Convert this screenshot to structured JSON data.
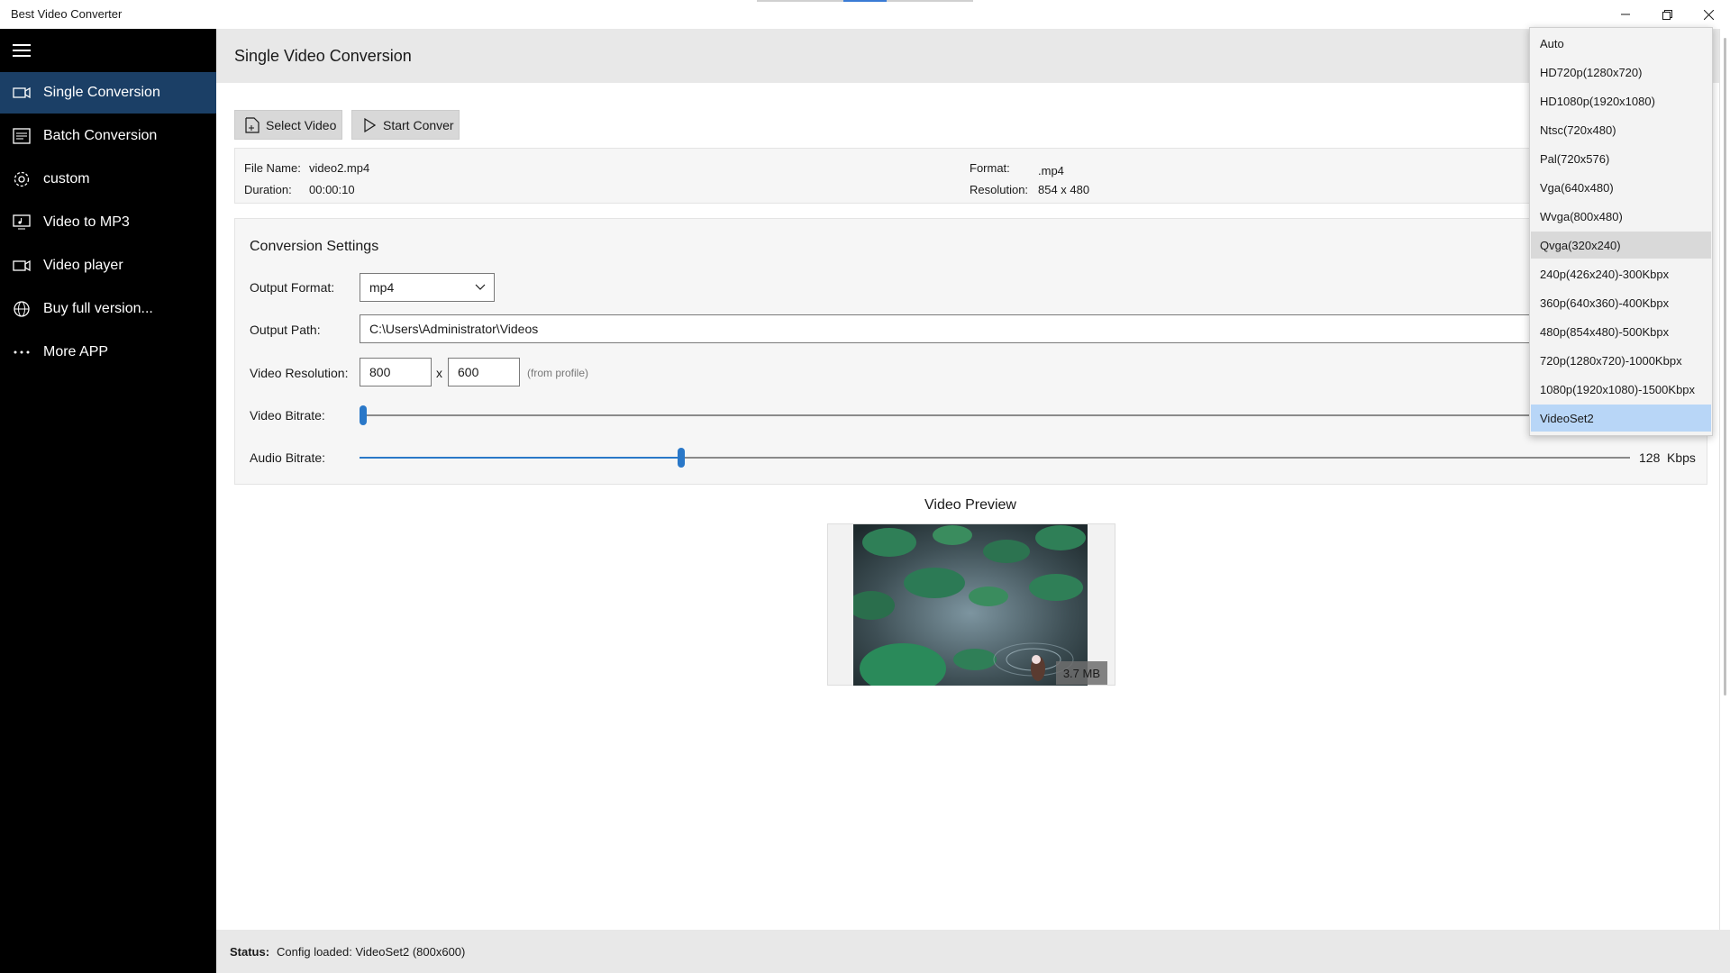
{
  "window": {
    "title": "Best Video Converter",
    "controls": [
      "minimize-icon",
      "restore-icon",
      "close-icon"
    ]
  },
  "sidebar": {
    "menu_icon": "hamburger-icon",
    "items": [
      {
        "label": "Single Conversion",
        "icon": "video-camera-icon",
        "active": true
      },
      {
        "label": "Batch Conversion",
        "icon": "batch-list-icon",
        "active": false
      },
      {
        "label": "custom",
        "icon": "gear-icon",
        "active": false
      },
      {
        "label": "Video to MP3",
        "icon": "music-screen-icon",
        "active": false
      },
      {
        "label": "Video player",
        "icon": "video-camera-icon",
        "active": false
      },
      {
        "label": "Buy full version...",
        "icon": "globe-icon",
        "active": false
      },
      {
        "label": "More APP",
        "icon": "more-dots-icon",
        "active": false
      }
    ]
  },
  "header": {
    "title": "Single Video Conversion"
  },
  "toolbar": {
    "select_label": "Select Video",
    "start_label": "Start Conver"
  },
  "file_info": {
    "file_name_label": "File Name:",
    "file_name": "video2.mp4",
    "duration_label": "Duration:",
    "duration": "00:00:10",
    "format_label": "Format:",
    "format": ".mp4",
    "resolution_label": "Resolution:",
    "resolution": "854 x 480"
  },
  "settings": {
    "title": "Conversion Settings",
    "output_format_label": "Output Format:",
    "output_format": "mp4",
    "output_path_label": "Output Path:",
    "output_path": "C:\\Users\\Administrator\\Videos",
    "resolution_label": "Video Resolution:",
    "width": "800",
    "x_sep": "x",
    "height": "600",
    "resolution_hint": "(from profile)",
    "video_bitrate_label": "Video Bitrate:",
    "video_bitrate_level": 0.0,
    "audio_bitrate_label": "Audio Bitrate:",
    "audio_bitrate_level": 0.25,
    "audio_bitrate_value": "128",
    "audio_bitrate_unit": "Kbps"
  },
  "preview": {
    "title": "Video Preview",
    "size_badge": "3.7 MB"
  },
  "status": {
    "label": "Status:",
    "text": "Config loaded: VideoSet2 (800x600)"
  },
  "profile_dropdown": {
    "items": [
      "Auto",
      "HD720p(1280x720)",
      "HD1080p(1920x1080)",
      "Ntsc(720x480)",
      "Pal(720x576)",
      "Vga(640x480)",
      "Wvga(800x480)",
      "Qvga(320x240)",
      "240p(426x240)-300Kbpx",
      "360p(640x360)-400Kbpx",
      "480p(854x480)-500Kbpx",
      "720p(1280x720)-1000Kbpx",
      "1080p(1920x1080)-1500Kbpx",
      "VideoSet2"
    ],
    "hovered": "Qvga(320x240)",
    "selected": "VideoSet2"
  },
  "colors": {
    "accent": "#2a78c8",
    "sidebar_bg": "#000000",
    "sidebar_active": "#1b3f66",
    "selected_item": "#b8d6f7"
  }
}
